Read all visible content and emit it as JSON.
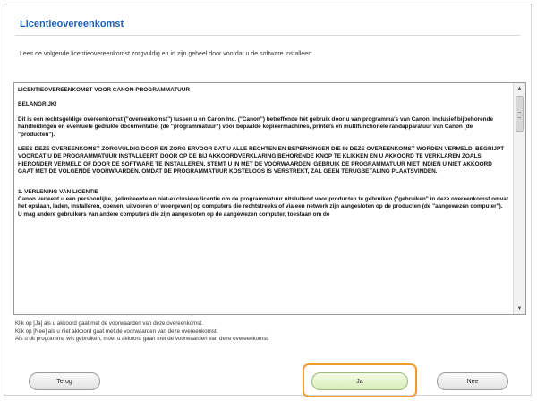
{
  "dialog": {
    "title": "Licentieovereenkomst",
    "instruction": "Lees de volgende licentieovereenkomst zorgvuldig en in zijn geheel door voordat u de software installeert."
  },
  "license": {
    "heading": "LICENTIEOVEREENKOMST VOOR CANON-PROGRAMMATUUR",
    "important": "BELANGRIJK!",
    "para1": "Dit is een rechtsgeldige overeenkomst (\"overeenkomst\") tussen u en Canon Inc. (\"Canon\") betreffende het gebruik door u van programma's van Canon, inclusief bijbehorende handleidingen en eventuele gedrukte documentatie, (de \"programmatuur\") voor bepaalde kopieermachines, printers en multifunctionele randapparatuur van Canon (de \"producten\").",
    "para2": "LEES DEZE OVEREENKOMST ZORGVULDIG DOOR EN ZORG ERVOOR DAT U ALLE RECHTEN EN BEPERKINGEN DIE IN DEZE OVEREENKOMST WORDEN VERMELD, BEGRIJPT VOORDAT U DE PROGRAMMATUUR INSTALLEERT. DOOR OP DE BIJ AKKOORDVERKLARING BEHORENDE KNOP TE KLIKKEN EN U AKKOORD TE VERKLAREN ZOALS HIERONDER VERMELD OF DOOR DE SOFTWARE TE INSTALLEREN, STEMT U IN MET DE VOORWAARDEN. GEBRUIK DE PROGRAMMATUUR NIET INDIEN U NIET AKKOORD GAAT MET DE VOLGENDE VOORWAARDEN. OMDAT DE PROGRAMMATUUR KOSTELOOS IS VERSTREKT, ZAL GEEN TERUGBETALING PLAATSVINDEN.",
    "section1_title": "1. VERLENING VAN LICENTIE",
    "section1_body": "Canon verleent u een persoonlijke, gelimiteerde en niet-exclusieve licentie om de programmatuur uitsluitend voor producten te gebruiken (\"gebruiken\" in deze overeenkomst omvat het opslaan, laden, installeren, openen, uitvoeren of weergeven) op computers die rechtstreeks of via een netwerk zijn aangesloten op de producten (de \"aangewezen computer\").",
    "section1_cont": "U mag andere gebruikers van andere computers die zijn aangesloten op de aangewezen computer, toestaan om de"
  },
  "notes": {
    "line1": "Klik op [Ja] als u akkoord gaat met de voorwaarden van deze overeenkomst.",
    "line2": "Klik op [Nee] als u niet akkoord gaat met de voorwaarden van deze overeenkomst.",
    "line3": "Als u dit programma wilt gebruiken, moet u akkoord gaan met de voorwaarden van deze overeenkomst."
  },
  "buttons": {
    "back": "Terug",
    "yes": "Ja",
    "no": "Nee"
  },
  "scrollbar": {
    "up_glyph": "▲",
    "down_glyph": "▼"
  },
  "colors": {
    "title": "#1f5fb5",
    "highlight": "#f29a2e",
    "yes_button": "#d9edb8"
  }
}
